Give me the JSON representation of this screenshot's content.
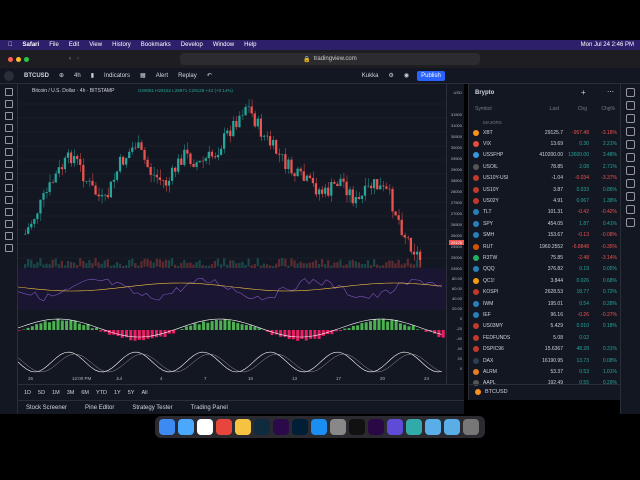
{
  "menubar": {
    "apple": "",
    "app": "Safari",
    "items": [
      "File",
      "Edit",
      "View",
      "History",
      "Bookmarks",
      "Develop",
      "Window",
      "Help"
    ],
    "clock": "Mon Jul 24  2:46 PM"
  },
  "browser": {
    "url": "tradingview.com"
  },
  "tv": {
    "symbol": "BTCUSD",
    "interval": "4h",
    "indicators_label": "Indicators",
    "alert_label": "Alert",
    "replay_label": "Replay",
    "user": "Kukka",
    "publish_label": "Publish",
    "title": "Bitcoin / U.S. Dollar · 4h · BITSTAMP",
    "ohlc": "O29081 H29152 L28971 C29126 +42 (+0.14%)",
    "currency": "USD"
  },
  "price_axis": [
    "31500",
    "31000",
    "30500",
    "30000",
    "29500",
    "29000",
    "28500",
    "28000",
    "27500",
    "27000",
    "26500",
    "26000",
    "25500",
    "25000",
    "24500"
  ],
  "last_price": "29126",
  "osc_axis": [
    "80.00",
    "60.00",
    "40.00",
    "20.00",
    "0",
    "-20",
    "-40",
    "40",
    "20",
    "0"
  ],
  "time_axis": [
    "26",
    "12:00 PM",
    "Jul",
    "4",
    "7",
    "10",
    "13",
    "17",
    "20",
    "24"
  ],
  "ranges": [
    "1D",
    "5D",
    "1M",
    "3M",
    "6M",
    "YTD",
    "1Y",
    "5Y",
    "All"
  ],
  "bottom_tabs": [
    "Stock Screener",
    "Pine Editor",
    "Strategy Tester",
    "Trading Panel"
  ],
  "watchlist": {
    "title": "Brypto",
    "section": "MAJORS",
    "headers": {
      "symbol": "Symbol",
      "last": "Last",
      "chg": "Chg",
      "pct": "Chg%"
    },
    "rows": [
      {
        "sym": "XBT",
        "last": "29125.7",
        "chg": "-957.48",
        "pct": "-3.18%",
        "c": "#f7931a",
        "neg": true
      },
      {
        "sym": "VIX",
        "last": "13.69",
        "chg": "0.30",
        "pct": "2.21%",
        "c": "#e74c3c",
        "neg": false
      },
      {
        "sym": "USSFHP",
        "last": "410200.00",
        "chg": "13600.00",
        "pct": "3.48%",
        "c": "#3498db",
        "neg": false
      },
      {
        "sym": "USOIL",
        "last": "78.85",
        "chg": "2.08",
        "pct": "2.71%",
        "c": "#555",
        "neg": false
      },
      {
        "sym": "US10Y-USI",
        "last": "-1.04",
        "chg": "-0.034",
        "pct": "-3.37%",
        "c": "#c0392b",
        "neg": true
      },
      {
        "sym": "US10Y",
        "last": "3.87",
        "chg": "0.033",
        "pct": "0.86%",
        "c": "#c0392b",
        "neg": false
      },
      {
        "sym": "US02Y",
        "last": "4.91",
        "chg": "0.067",
        "pct": "1.38%",
        "c": "#c0392b",
        "neg": false
      },
      {
        "sym": "TLT",
        "last": "101.31",
        "chg": "-0.42",
        "pct": "-0.42%",
        "c": "#2980b9",
        "neg": true
      },
      {
        "sym": "SPY",
        "last": "454.05",
        "chg": "1.87",
        "pct": "0.41%",
        "c": "#2980b9",
        "neg": false
      },
      {
        "sym": "SMH",
        "last": "153.67",
        "chg": "-0.13",
        "pct": "-0.08%",
        "c": "#2980b9",
        "neg": true
      },
      {
        "sym": "RUT",
        "last": "1960.2552",
        "chg": "-6.8848",
        "pct": "-0.35%",
        "c": "#d35400",
        "neg": true
      },
      {
        "sym": "R3TW",
        "last": "75.85",
        "chg": "-2.48",
        "pct": "-3.14%",
        "c": "#27ae60",
        "neg": true
      },
      {
        "sym": "QQQ",
        "last": "376.82",
        "chg": "0.19",
        "pct": "0.05%",
        "c": "#2980b9",
        "neg": false
      },
      {
        "sym": "QC1!",
        "last": "3.844",
        "chg": "0.026",
        "pct": "0.68%",
        "c": "#f39c12",
        "neg": false
      },
      {
        "sym": "KOSPI",
        "last": "2628.53",
        "chg": "18.77",
        "pct": "0.72%",
        "c": "#c0392b",
        "neg": false
      },
      {
        "sym": "IWM",
        "last": "195.01",
        "chg": "0.54",
        "pct": "0.28%",
        "c": "#2980b9",
        "neg": false
      },
      {
        "sym": "IEF",
        "last": "96.16",
        "chg": "-0.26",
        "pct": "-0.27%",
        "c": "#2980b9",
        "neg": true
      },
      {
        "sym": "US03MY",
        "last": "5.429",
        "chg": "0.010",
        "pct": "0.18%",
        "c": "#c0392b",
        "neg": false
      },
      {
        "sym": "FEDFUNDS",
        "last": "5.08",
        "chg": "0.02",
        "pct": "",
        "c": "#c0392b",
        "neg": false
      },
      {
        "sym": "DSPIC96",
        "last": "15.6367",
        "chg": "48.28",
        "pct": "0.31%",
        "c": "#c0392b",
        "neg": false
      },
      {
        "sym": "DAX",
        "last": "16190.95",
        "chg": "13.73",
        "pct": "0.08%",
        "c": "#2c3e50",
        "neg": false
      },
      {
        "sym": "ALRM",
        "last": "53.37",
        "chg": "0.53",
        "pct": "1.01%",
        "c": "#e67e22",
        "neg": false
      },
      {
        "sym": "AAPL",
        "last": "192.49",
        "chg": "0.55",
        "pct": "0.29%",
        "c": "#555",
        "neg": false
      }
    ],
    "footer": "BTCUSD"
  },
  "colors": {
    "up": "#26a69a",
    "down": "#ef5350",
    "bg": "#131722",
    "accent": "#2962ff"
  }
}
